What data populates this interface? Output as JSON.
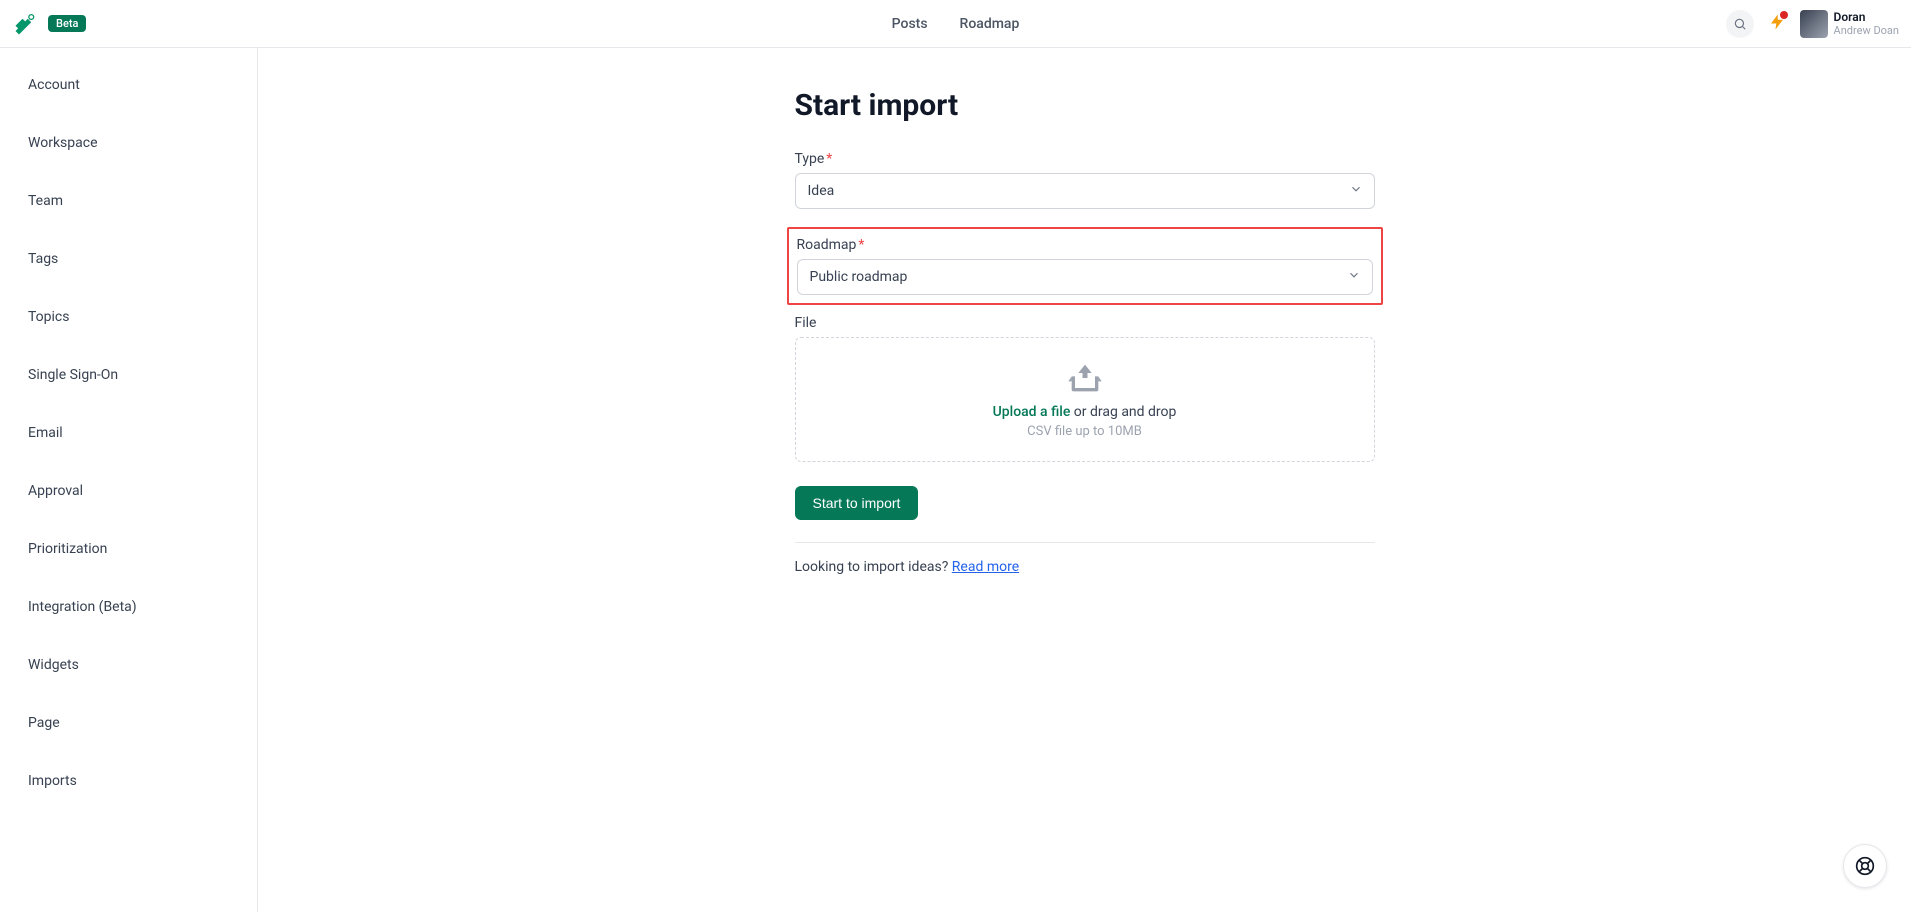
{
  "header": {
    "badge": "Beta",
    "nav": {
      "posts": "Posts",
      "roadmap": "Roadmap"
    },
    "user": {
      "name": "Doran",
      "fullname": "Andrew Doan"
    }
  },
  "sidebar": {
    "items": [
      {
        "label": "Account"
      },
      {
        "label": "Workspace"
      },
      {
        "label": "Team"
      },
      {
        "label": "Tags"
      },
      {
        "label": "Topics"
      },
      {
        "label": "Single Sign-On"
      },
      {
        "label": "Email"
      },
      {
        "label": "Approval"
      },
      {
        "label": "Prioritization"
      },
      {
        "label": "Integration (Beta)"
      },
      {
        "label": "Widgets"
      },
      {
        "label": "Page"
      },
      {
        "label": "Imports"
      }
    ]
  },
  "main": {
    "title": "Start import",
    "fields": {
      "type": {
        "label": "Type",
        "value": "Idea"
      },
      "roadmap": {
        "label": "Roadmap",
        "value": "Public roadmap"
      },
      "file": {
        "label": "File",
        "upload_link": "Upload a file",
        "drag_text": " or drag and drop",
        "hint": "CSV file up to 10MB"
      }
    },
    "submit": "Start to import",
    "help": {
      "text": "Looking to import ideas? ",
      "link": "Read more"
    }
  }
}
